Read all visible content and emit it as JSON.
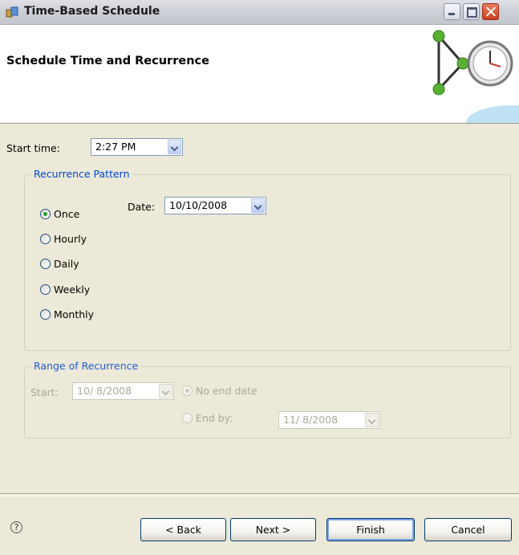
{
  "window": {
    "title": "Time-Based Schedule"
  },
  "banner": {
    "title": "Schedule Time and Recurrence"
  },
  "start_time": {
    "label": "Start time:",
    "value": "2:27 PM"
  },
  "recurrence_pattern": {
    "legend": "Recurrence Pattern",
    "date_label": "Date:",
    "date_value": "10/10/2008",
    "options": [
      {
        "label": "Once",
        "selected": true
      },
      {
        "label": "Hourly",
        "selected": false
      },
      {
        "label": "Daily",
        "selected": false
      },
      {
        "label": "Weekly",
        "selected": false
      },
      {
        "label": "Monthly",
        "selected": false
      }
    ]
  },
  "range_of_recurrence": {
    "legend": "Range of Recurrence",
    "start_label": "Start:",
    "start_value": "10/ 8/2008",
    "no_end_date_label": "No end date",
    "end_by_label": "End by:",
    "end_by_value": "11/ 8/2008",
    "enabled": false
  },
  "footer": {
    "help_symbol": "?",
    "back_label": "< Back",
    "next_label": "Next >",
    "finish_label": "Finish",
    "cancel_label": "Cancel"
  },
  "colors": {
    "legend_blue": "#0046d5",
    "dialog_bg": "#ece9d8",
    "banner_bg": "#ffffff",
    "disabled_text": "#aca899"
  },
  "icons": {
    "app": "schedule-app-icon",
    "banner": "workflow-clock-icon",
    "help": "help-icon"
  }
}
